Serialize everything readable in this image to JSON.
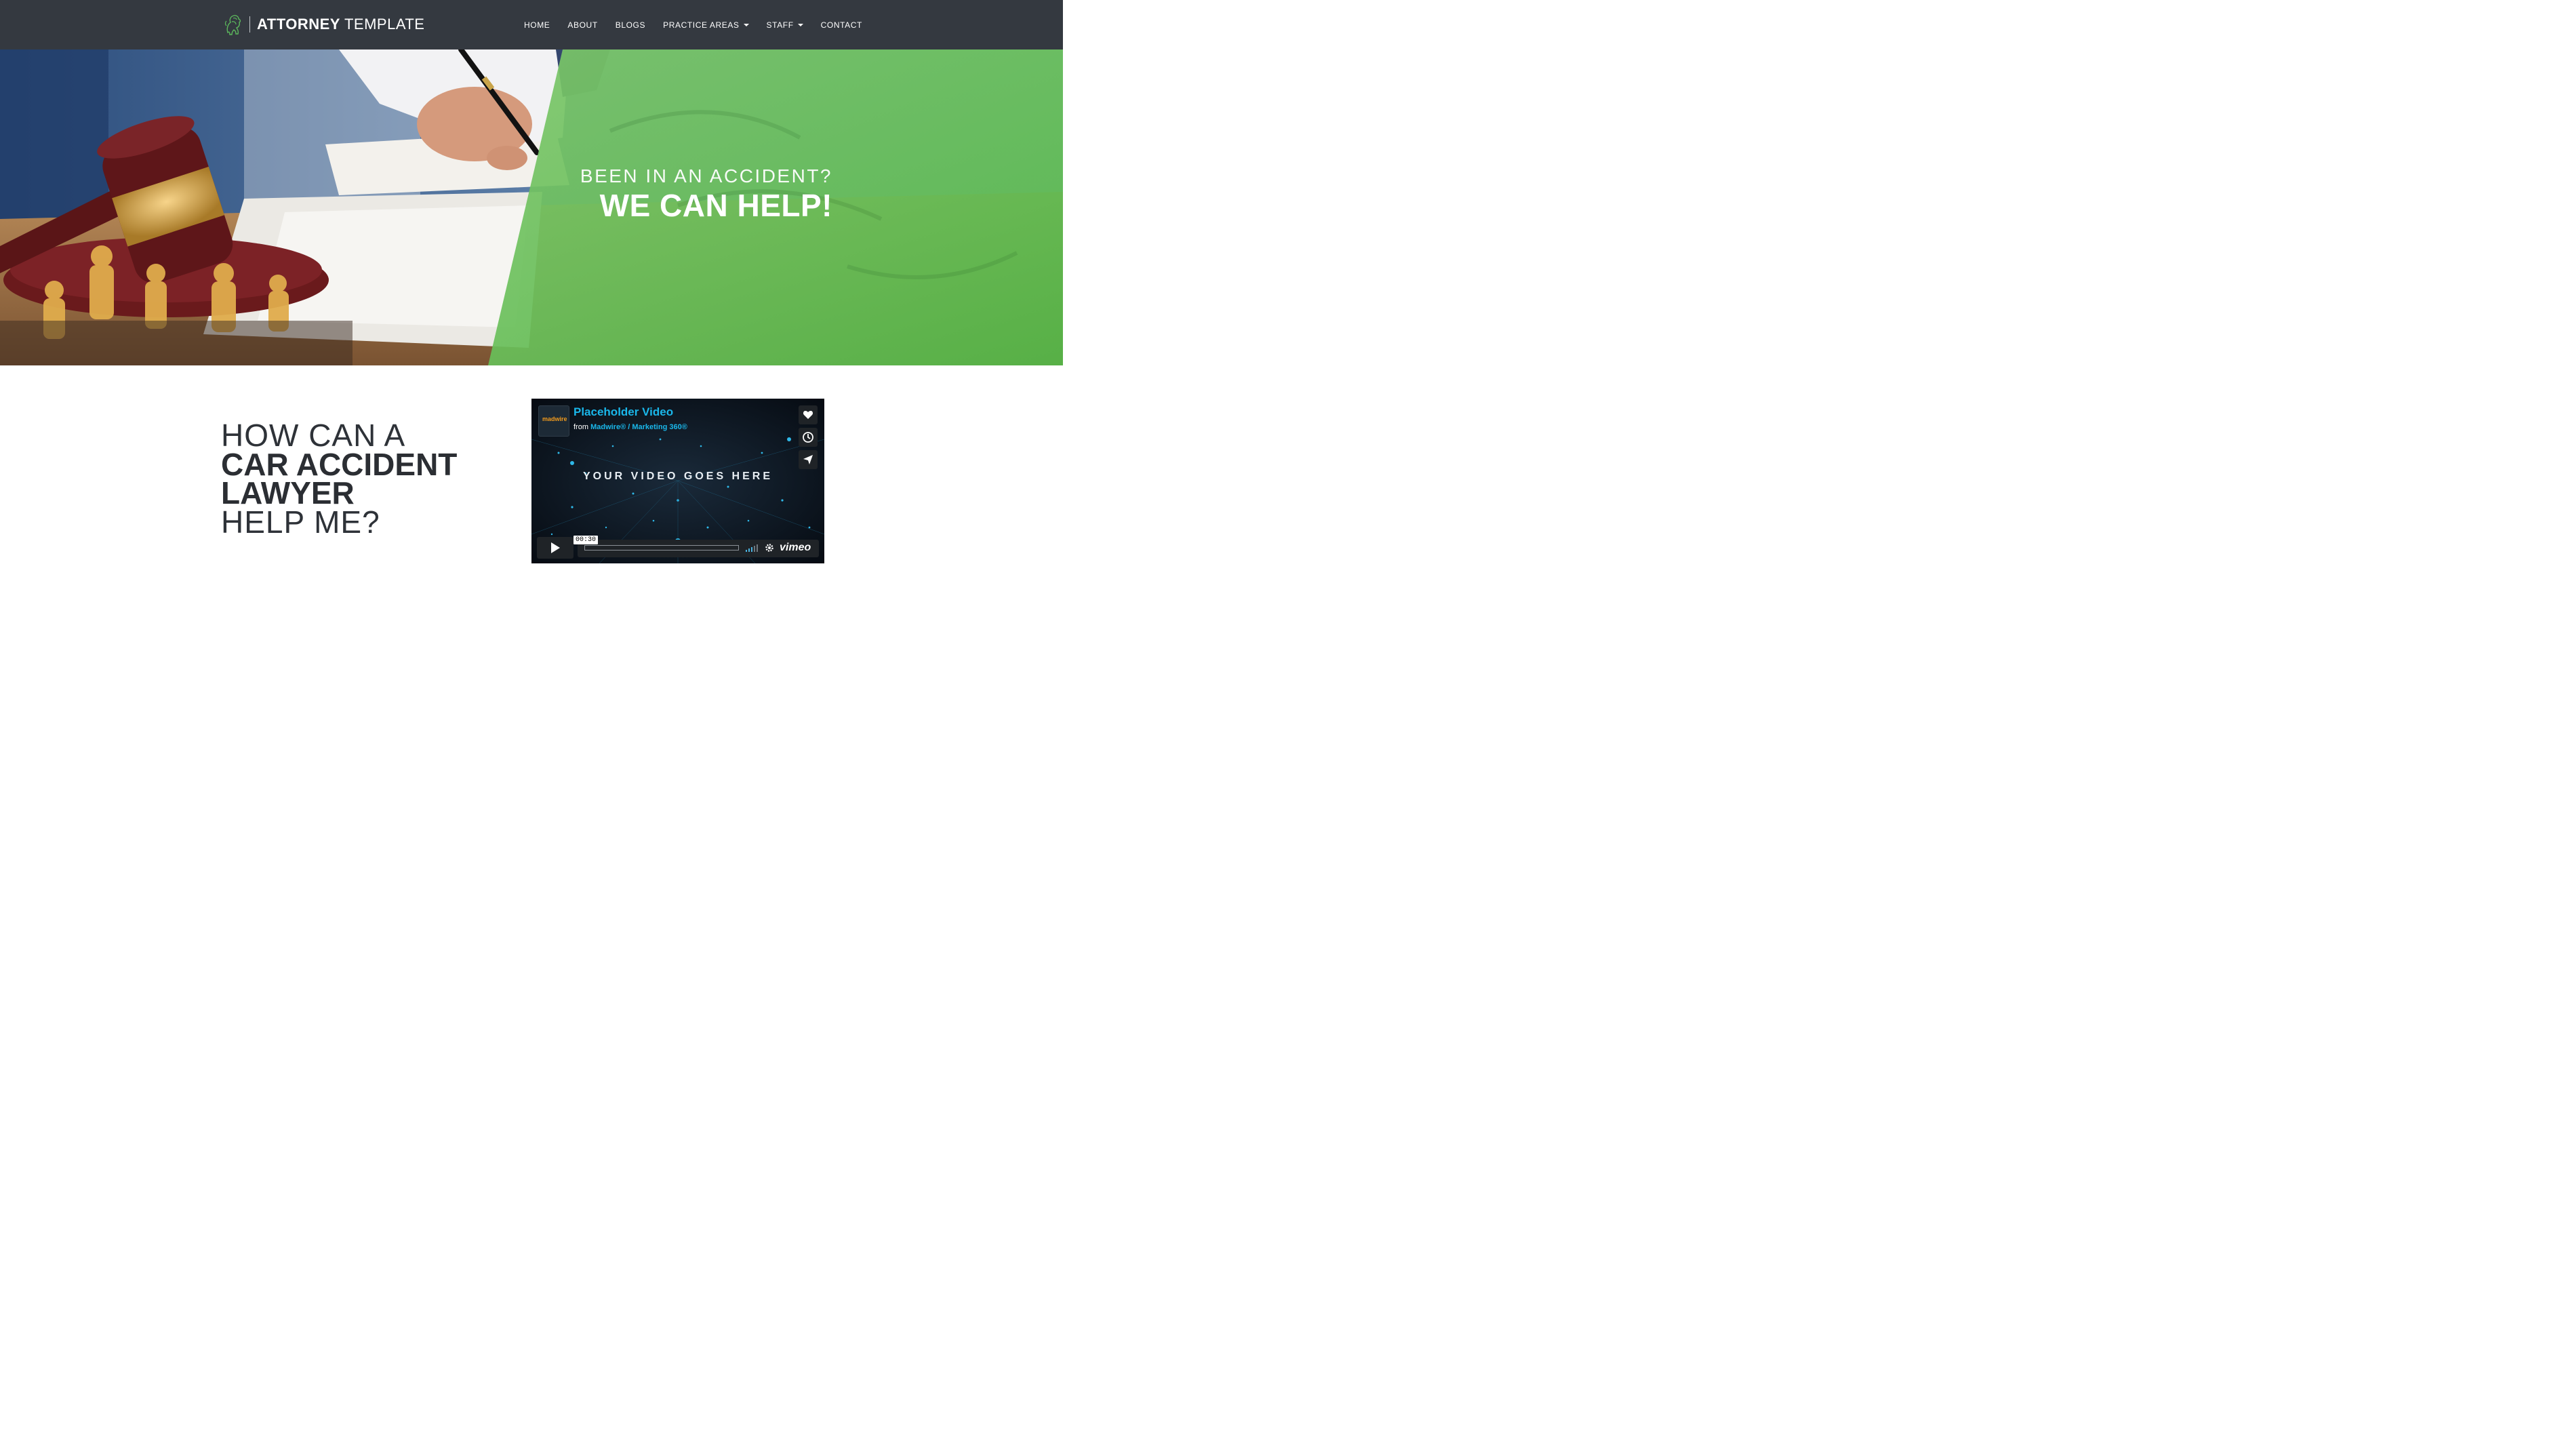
{
  "brand": {
    "bold": "ATTORNEY",
    "light": "TEMPLATE",
    "accent_color": "#4caf50"
  },
  "nav": {
    "items": [
      {
        "label": "HOME",
        "has_dropdown": false
      },
      {
        "label": "ABOUT",
        "has_dropdown": false
      },
      {
        "label": "BLOGS",
        "has_dropdown": false
      },
      {
        "label": "PRACTICE AREAS",
        "has_dropdown": true
      },
      {
        "label": "STAFF",
        "has_dropdown": true
      },
      {
        "label": "CONTACT",
        "has_dropdown": false
      }
    ]
  },
  "hero": {
    "pre_heading": "BEEN IN AN ACCIDENT?",
    "heading": "WE CAN HELP!",
    "overlay_color": "#6cc04a"
  },
  "content": {
    "headline": {
      "line1": "HOW CAN A",
      "line2": "CAR ACCIDENT",
      "line3": "LAWYER",
      "line4": "HELP ME?"
    }
  },
  "video": {
    "title": "Placeholder Video",
    "from_prefix": "from",
    "from_channel": "Madwire® / Marketing 360®",
    "channel_logo": "madwire",
    "center_text": "YOUR VIDEO GOES HERE",
    "timestamp": "00:30",
    "player_brand": "vimeo",
    "side_icons": [
      "heart-icon",
      "clock-icon",
      "send-icon"
    ]
  }
}
